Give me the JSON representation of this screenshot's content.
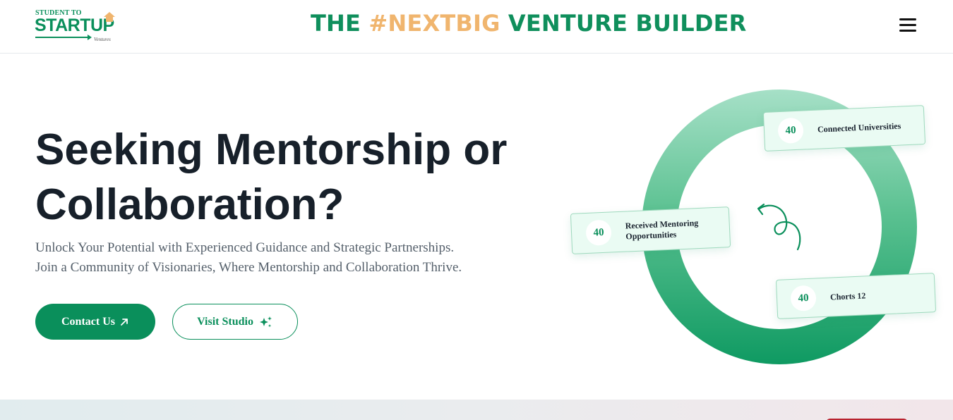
{
  "header": {
    "logo": {
      "line1": "STUDENT TO",
      "line2": "STARTUP",
      "line3": "Ventures"
    },
    "tagline": {
      "part1": "THE ",
      "part2": "#NEXTBIG",
      "part3": " VENTURE BUILDER"
    },
    "menu_icon": "hamburger-icon"
  },
  "hero": {
    "title_line1": "Seeking Mentorship or",
    "title_line2": "Collaboration?",
    "subtitle_line1": "Unlock Your Potential with Experienced Guidance and Strategic Partnerships.",
    "subtitle_line2": "Join a Community of Visionaries, Where Mentorship and Collaboration Thrive.",
    "contact_label": "Contact Us",
    "contact_icon": "arrow-up-right-icon",
    "studio_label": "Visit Studio",
    "studio_icon": "sparkles-icon"
  },
  "stats": [
    {
      "value": "40",
      "label": "Connected Universities"
    },
    {
      "value": "40",
      "label_line1": "Received Mentoring",
      "label_line2": "Opportunities"
    },
    {
      "value": "40",
      "label": "Chorts 12"
    }
  ],
  "colors": {
    "brand_green": "#0a8f5b",
    "accent_orange": "#f0b56e",
    "heading": "#17202a",
    "body_text": "#55606b"
  }
}
